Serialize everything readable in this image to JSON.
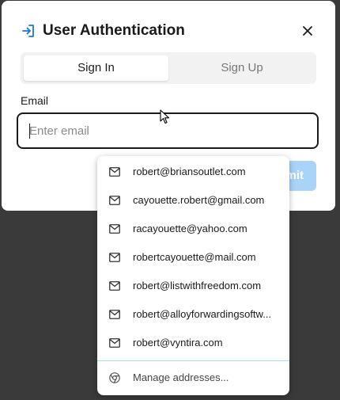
{
  "dialog": {
    "title": "User Authentication",
    "title_icon": "login-arrow-icon",
    "close_icon": "close-icon",
    "tabs": [
      {
        "label": "Sign In",
        "active": true
      },
      {
        "label": "Sign Up",
        "active": false
      }
    ],
    "email_label": "Email",
    "email_placeholder": "Enter email",
    "email_value": "",
    "submit_label": "mit"
  },
  "autofill": {
    "suggestions": [
      {
        "label": "robert@briansoutlet.com",
        "icon": "mail-icon"
      },
      {
        "label": "cayouette.robert@gmail.com",
        "icon": "mail-icon"
      },
      {
        "label": "racayouette@yahoo.com",
        "icon": "mail-icon"
      },
      {
        "label": "robertcayouette@mail.com",
        "icon": "mail-icon"
      },
      {
        "label": "robert@listwithfreedom.com",
        "icon": "mail-icon"
      },
      {
        "label": "robert@alloyforwardingsoftw...",
        "icon": "mail-icon"
      },
      {
        "label": "robert@vyntira.com",
        "icon": "mail-icon"
      }
    ],
    "manage_label": "Manage addresses...",
    "manage_icon": "chrome-icon"
  },
  "colors": {
    "accent_disabled": "#a9d3f7",
    "title_icon": "#1a73e8",
    "divider": "#a6dfe8"
  }
}
